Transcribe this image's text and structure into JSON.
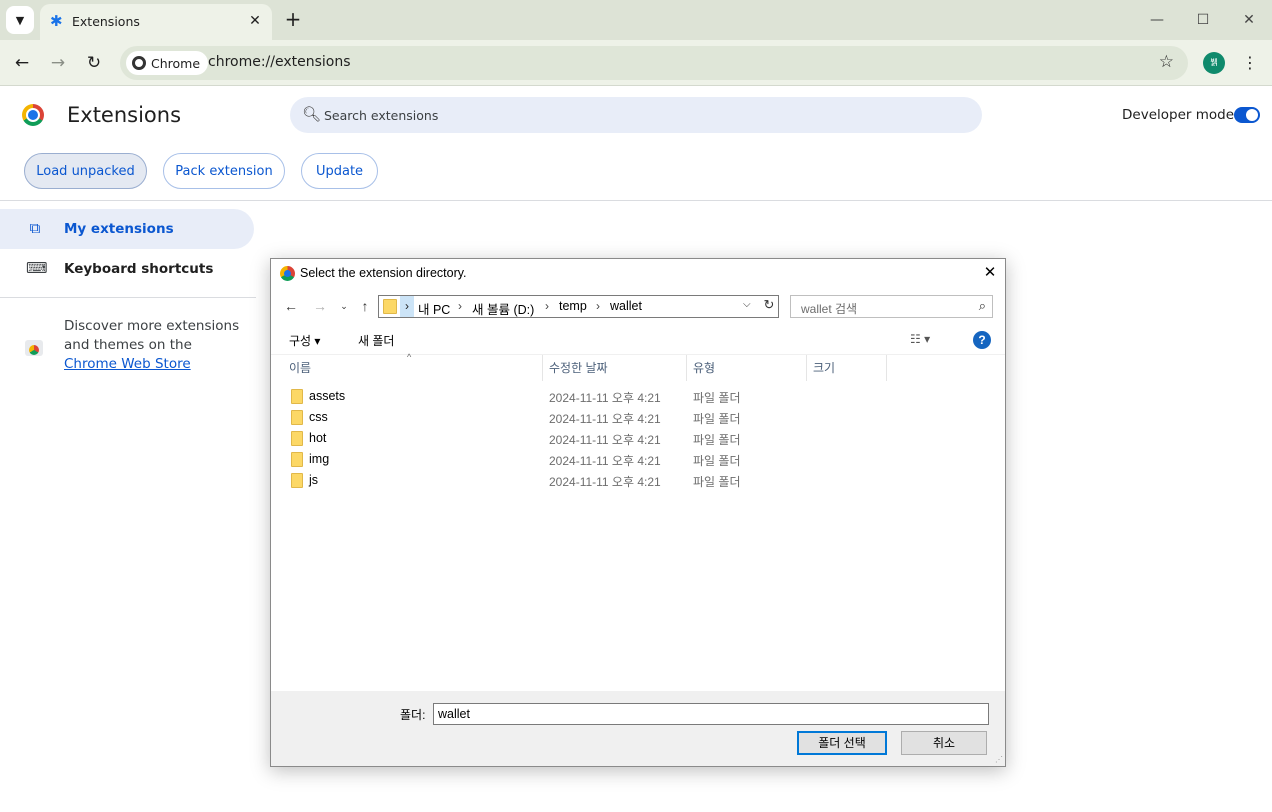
{
  "browser": {
    "tab": {
      "title": "Extensions"
    },
    "new_tab_symbol": "+",
    "window": {
      "minimize": "—",
      "maximize": "☐",
      "close": "✕"
    },
    "omnibox": {
      "chip_label": "Chrome",
      "url": "chrome://extensions"
    },
    "avatar_initial": "뷁"
  },
  "page": {
    "title": "Extensions",
    "search_placeholder": "Search extensions",
    "developer_mode_label": "Developer mode",
    "developer_mode_on": true,
    "actions": {
      "load_unpacked": "Load unpacked",
      "pack_extension": "Pack extension",
      "update": "Update"
    },
    "sidebar": {
      "my_extensions": "My extensions",
      "keyboard_shortcuts": "Keyboard shortcuts",
      "discover_text": "Discover more extensions and themes on the ",
      "discover_link": "Chrome Web Store"
    }
  },
  "dialog": {
    "title": "Select the extension directory.",
    "address": {
      "segments": [
        "내 PC",
        "새 볼륨 (D:)",
        "temp",
        "wallet"
      ]
    },
    "search_placeholder": "wallet 검색",
    "commands": {
      "organize": "구성 ▾",
      "new_folder": "새 폴더"
    },
    "columns": {
      "name": "이름",
      "modified": "수정한 날짜",
      "type": "유형",
      "size": "크기"
    },
    "files": [
      {
        "name": "assets",
        "modified": "2024-11-11 오후 4:21",
        "type": "파일 폴더"
      },
      {
        "name": "css",
        "modified": "2024-11-11 오후 4:21",
        "type": "파일 폴더"
      },
      {
        "name": "hot",
        "modified": "2024-11-11 오후 4:21",
        "type": "파일 폴더"
      },
      {
        "name": "img",
        "modified": "2024-11-11 오후 4:21",
        "type": "파일 폴더"
      },
      {
        "name": "js",
        "modified": "2024-11-11 오후 4:21",
        "type": "파일 폴더"
      }
    ],
    "folder_label": "폴더:",
    "folder_value": "wallet",
    "select_button": "폴더 선택",
    "cancel_button": "취소"
  },
  "colors": {
    "accent": "#0b57d0",
    "tabstrip": "#dde3d6",
    "toolbar": "#eef2e8",
    "dialog_primary": "#0078d7"
  }
}
